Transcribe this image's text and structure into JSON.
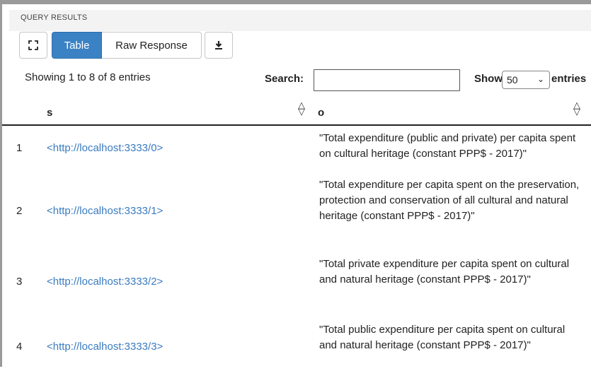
{
  "section": {
    "label": "QUERY RESULTS"
  },
  "toolbar": {
    "expand_icon": "expand-icon",
    "table_label": "Table",
    "raw_label": "Raw Response",
    "download_icon": "download-icon"
  },
  "info": {
    "showing": "Showing 1 to 8 of 8 entries"
  },
  "search": {
    "label": "Search:",
    "value": ""
  },
  "length": {
    "show_label": "Show",
    "selected": "50",
    "entries_label": "entries"
  },
  "columns": [
    {
      "label": "s"
    },
    {
      "label": "o"
    }
  ],
  "rows": [
    {
      "index": "1",
      "s": "<http://localhost:3333/0>",
      "o": "\"Total expenditure (public and private) per capita spent on cultural heritage (constant PPP$ - 2017)\""
    },
    {
      "index": "2",
      "s": "<http://localhost:3333/1>",
      "o": "\"Total expenditure per capita spent on the preservation, protection and conservation of all cultural and natural heritage (constant PPP$ - 2017)\""
    },
    {
      "index": "3",
      "s": "<http://localhost:3333/2>",
      "o": "\"Total private expenditure per capita spent on cultural and natural heritage (constant PPP$ - 2017)\""
    },
    {
      "index": "4",
      "s": "<http://localhost:3333/3>",
      "o": "\"Total public expenditure per capita spent on cultural and natural heritage (constant PPP$ - 2017)\""
    }
  ],
  "colors": {
    "accent": "#3b82c4",
    "link": "#3a7bbf"
  }
}
